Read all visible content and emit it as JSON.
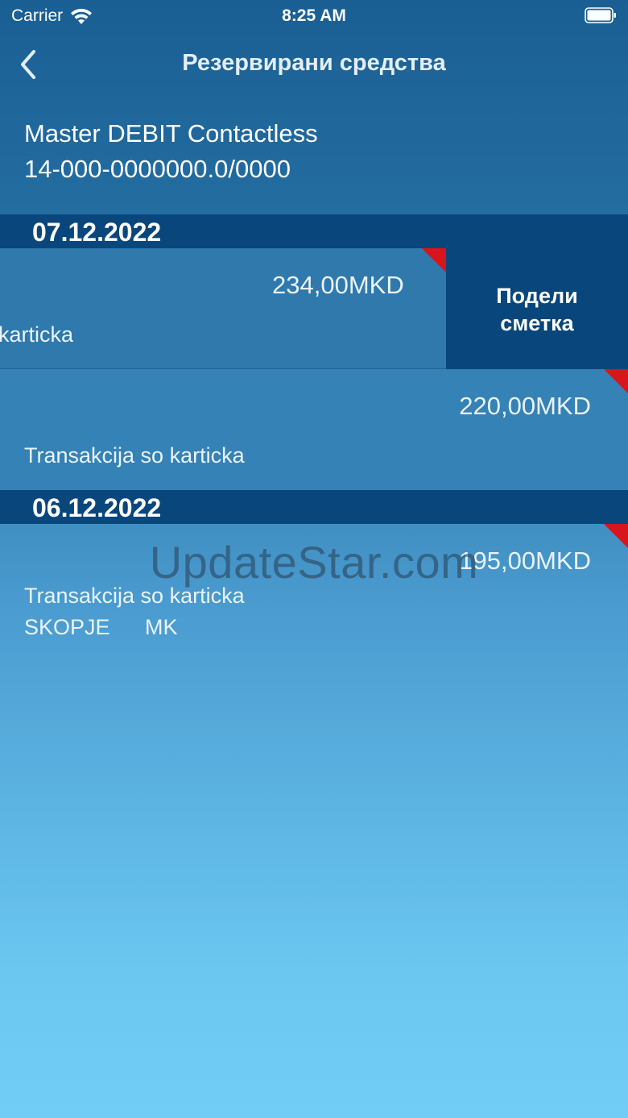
{
  "status_bar": {
    "carrier": "Carrier",
    "time": "8:25 AM"
  },
  "nav": {
    "title": "Резервирани средства",
    "back_icon": "chevron-left-icon"
  },
  "account": {
    "name": "Master DEBIT Contactless",
    "number": "14-000-0000000.0/0000"
  },
  "groups": [
    {
      "date": "07.12.2022",
      "transactions": [
        {
          "amount": "234,00MKD",
          "description": "karticka",
          "action_label_line1": "Подели",
          "action_label_line2": "сметка"
        },
        {
          "amount": "220,00MKD",
          "description": "Transakcija so karticka"
        }
      ]
    },
    {
      "date": "06.12.2022",
      "transactions": [
        {
          "amount": "195,00MKD",
          "description": "Transakcija so karticka",
          "city": "SKOPJE",
          "country": "MK"
        }
      ]
    }
  ],
  "watermark": "UpdateStar.com",
  "colors": {
    "header_band": "#08467c",
    "corner_marker": "#d8141c",
    "gradient_top": "#1a5f93",
    "gradient_bottom": "#72cdf6"
  }
}
